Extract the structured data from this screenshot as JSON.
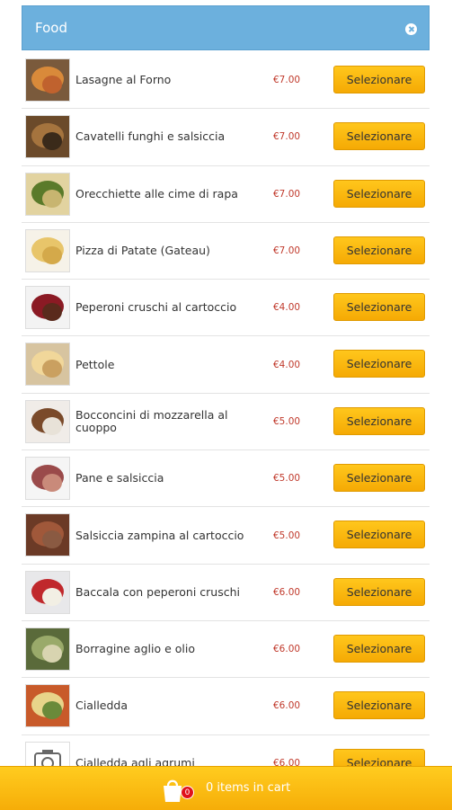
{
  "header": {
    "title": "Food"
  },
  "items": [
    {
      "name": "Lasagne al Forno",
      "price": "€7.00",
      "button": "Selezionare",
      "thumb_colors": [
        "#7a5a3c",
        "#d98a3a",
        "#c0622e"
      ]
    },
    {
      "name": "Cavatelli funghi e salsiccia",
      "price": "€7.00",
      "button": "Selezionare",
      "thumb_colors": [
        "#6b4a2a",
        "#a5743e",
        "#3a2a1a"
      ]
    },
    {
      "name": "Orecchiette alle cime di rapa",
      "price": "€7.00",
      "button": "Selezionare",
      "thumb_colors": [
        "#e2d3a0",
        "#5a7a2a",
        "#c8b570"
      ]
    },
    {
      "name": "Pizza di Patate (Gateau)",
      "price": "€7.00",
      "button": "Selezionare",
      "thumb_colors": [
        "#f6f2e8",
        "#e8c56a",
        "#d4a94a"
      ]
    },
    {
      "name": "Peperoni cruschi al cartoccio",
      "price": "€4.00",
      "button": "Selezionare",
      "thumb_colors": [
        "#f3f3f3",
        "#8b1a24",
        "#5a2a1c"
      ]
    },
    {
      "name": "Pettole",
      "price": "€4.00",
      "button": "Selezionare",
      "thumb_colors": [
        "#d7c4a0",
        "#f1d79a",
        "#caa060"
      ]
    },
    {
      "name": "Bocconcini di mozzarella al cuoppo",
      "price": "€5.00",
      "button": "Selezionare",
      "thumb_colors": [
        "#f0ece8",
        "#7a4a2a",
        "#e8e2d8"
      ]
    },
    {
      "name": "Pane e salsiccia",
      "price": "€5.00",
      "button": "Selezionare",
      "thumb_colors": [
        "#f5f5f5",
        "#9a4a4a",
        "#c98a7a"
      ]
    },
    {
      "name": "Salsiccia zampina al cartoccio",
      "price": "€5.00",
      "button": "Selezionare",
      "thumb_colors": [
        "#6b3a26",
        "#a0583a",
        "#8a5a42"
      ]
    },
    {
      "name": "Baccala con peperoni cruschi",
      "price": "€6.00",
      "button": "Selezionare",
      "thumb_colors": [
        "#e8e8ea",
        "#c0282c",
        "#f2efe4"
      ]
    },
    {
      "name": "Borragine aglio e olio",
      "price": "€6.00",
      "button": "Selezionare",
      "thumb_colors": [
        "#5a6a3a",
        "#9aaa6a",
        "#d8d4b0"
      ]
    },
    {
      "name": "Cialledda",
      "price": "€6.00",
      "button": "Selezionare",
      "thumb_colors": [
        "#c85a2a",
        "#e8d48a",
        "#6a8a3a"
      ]
    },
    {
      "name": "Cialledda agli agrumi",
      "price": "€6.00",
      "button": "Selezionare",
      "thumb_colors": [
        "#ffffff",
        "#666666",
        "#999999"
      ]
    }
  ],
  "cart": {
    "count": "0",
    "label": "0 items in cart"
  }
}
